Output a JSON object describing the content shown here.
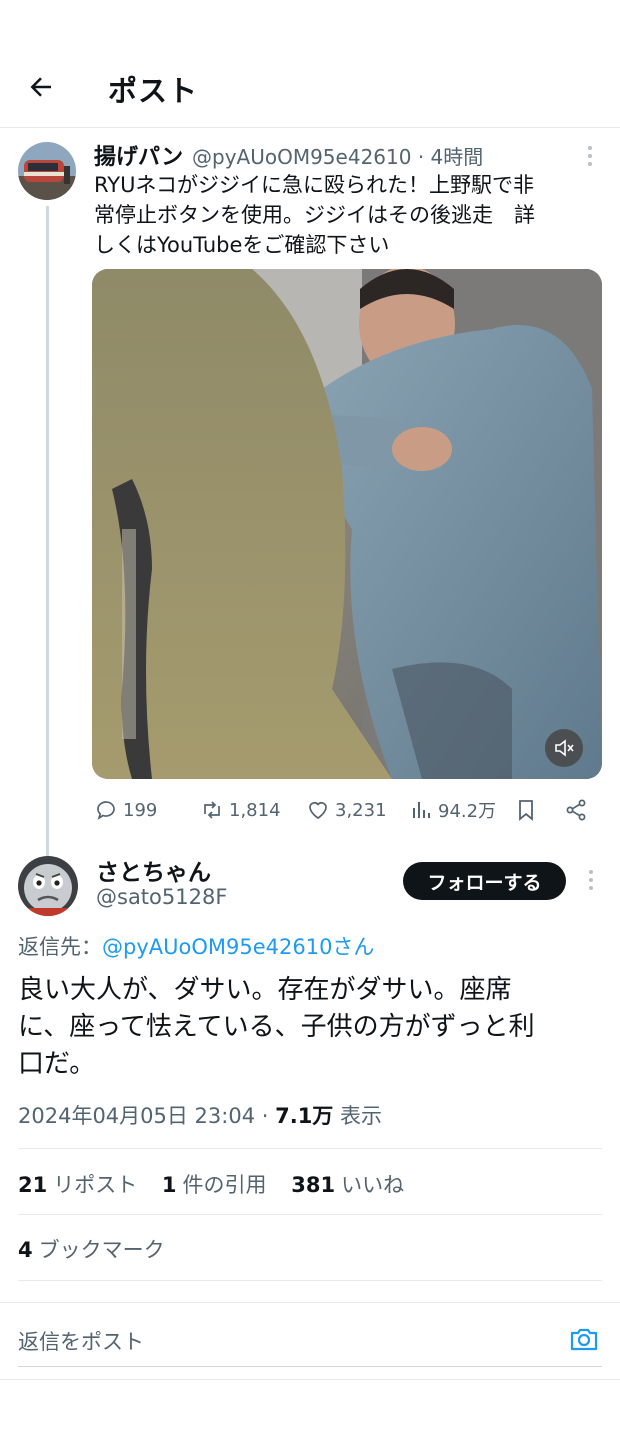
{
  "header": {
    "title": "ポスト",
    "back_icon": "arrow-left-icon"
  },
  "parent_post": {
    "author_name": "揚げパン",
    "handle_time": "@pyAUoOM95e42610 · 4時間",
    "text": "RYUネコがジジイに急に殴られた！上野駅で非\n常停止ボタンを使用。ジジイはその後逃走　詳\nしくはYouTubeをご確認下さい",
    "actions": {
      "replies": "199",
      "reposts": "1,814",
      "likes": "3,231",
      "views": "94.2万"
    }
  },
  "reply_post": {
    "author_name": "さとちゃん",
    "handle": "@sato5128F",
    "follow_label": "フォローする",
    "reply_to_prefix": "返信先：",
    "reply_to_link": "@pyAUoOM95e42610さん",
    "text": "良い大人が、ダサい。存在がダサい。座席\nに、座って怯えている、子供の方がずっと利\n口だ。",
    "date": "2024年04月05日 23:04 · ",
    "views_count": "7.1万",
    "views_label": " 表示",
    "reposts_count": "21",
    "reposts_label": "リポスト",
    "quotes_count": "1",
    "quotes_label": "件の引用",
    "likes_count": "381",
    "likes_label": "いいね",
    "bookmarks_count": "4",
    "bookmarks_label": "ブックマーク"
  },
  "reply_composer": {
    "placeholder": "返信をポスト"
  },
  "colors": {
    "accent": "#1d9bf0",
    "text": "#0f1419",
    "muted": "#536471",
    "border": "#e7e9ea"
  }
}
